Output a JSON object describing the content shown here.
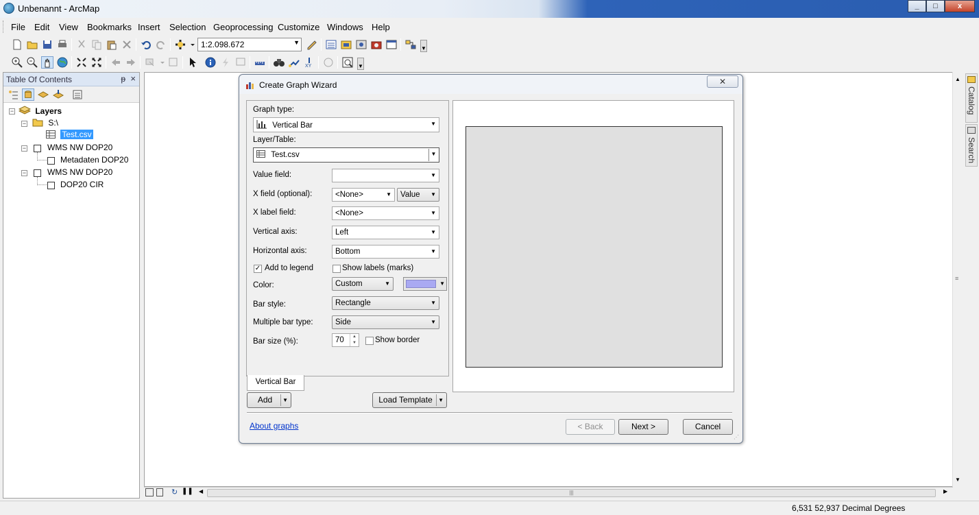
{
  "window": {
    "title": "Unbenannt - ArcMap",
    "btn_min": "_",
    "btn_max": "□",
    "btn_close": "x"
  },
  "menu": [
    "File",
    "Edit",
    "View",
    "Bookmarks",
    "Insert",
    "Selection",
    "Geoprocessing",
    "Customize",
    "Windows",
    "Help"
  ],
  "toolbar": {
    "scale": "1:2.098.672"
  },
  "toc": {
    "header": "Table Of Contents",
    "pin": "ᵽ",
    "close": "×",
    "root": "Layers",
    "items": [
      {
        "label": "S:\\"
      },
      {
        "label": "Test.csv"
      },
      {
        "label": "WMS NW DOP20"
      },
      {
        "label": "Metadaten DOP20"
      },
      {
        "label": "WMS NW DOP20"
      },
      {
        "label": "DOP20 CIR"
      }
    ]
  },
  "right_dock": {
    "catalog": "Catalog",
    "search": "Search"
  },
  "status": {
    "coords": "6,531  52,937 Decimal Degrees"
  },
  "dialog": {
    "title": "Create Graph Wizard",
    "close": "✕",
    "graph_type_label": "Graph type:",
    "graph_type_value": "Vertical Bar",
    "layer_label": "Layer/Table:",
    "layer_value": "Test.csv",
    "value_field_label": "Value field:",
    "value_field_value": "",
    "x_field_label": "X field (optional):",
    "x_field_value": "<None>",
    "x_field_sort": "Value",
    "x_label_label": "X label field:",
    "x_label_value": "<None>",
    "vertical_axis_label": "Vertical axis:",
    "vertical_axis_value": "Left",
    "horizontal_axis_label": "Horizontal axis:",
    "horizontal_axis_value": "Bottom",
    "add_legend_label": "Add to legend",
    "add_legend_checked": true,
    "show_labels_label": "Show labels (marks)",
    "show_labels_checked": false,
    "color_label": "Color:",
    "color_value": "Custom",
    "color_swatch": "#a9a9f2",
    "bar_style_label": "Bar style:",
    "bar_style_value": "Rectangle",
    "multi_bar_label": "Multiple bar type:",
    "multi_bar_value": "Side",
    "bar_size_label": "Bar size (%):",
    "bar_size_value": "70",
    "show_border_label": "Show border",
    "show_border_checked": false,
    "tab_label": "Vertical Bar",
    "add_button": "Add",
    "load_template_button": "Load Template",
    "about_link": "About graphs",
    "back_button": "< Back",
    "next_button": "Next >",
    "cancel_button": "Cancel"
  }
}
